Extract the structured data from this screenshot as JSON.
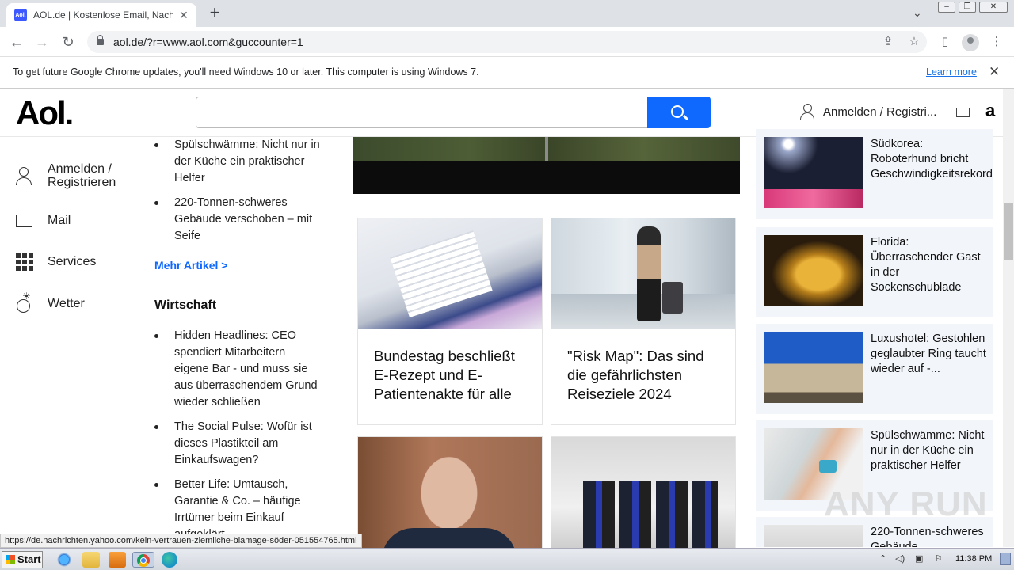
{
  "browser": {
    "tab_title": "AOL.de | Kostenlose Email, Nachrichten",
    "favicon_text": "Aol.",
    "url": "aol.de/?r=www.aol.com&guccounter=1",
    "infobar_message": "To get future Google Chrome updates, you'll need Windows 10 or later. This computer is using Windows 7.",
    "infobar_link": "Learn more",
    "status_url": "https://de.nachrichten.yahoo.com/kein-vertrauen-ziemliche-blamage-söder-051554765.html"
  },
  "header": {
    "logo": "Aol.",
    "search_placeholder": "",
    "login_label": "Anmelden / Registri...",
    "amazon": "a"
  },
  "left_nav": {
    "items": [
      {
        "label": "Anmelden / Registrieren",
        "icon": "person-icon"
      },
      {
        "label": "Mail",
        "icon": "mail-icon"
      },
      {
        "label": "Services",
        "icon": "grid-icon"
      },
      {
        "label": "Wetter",
        "icon": "weather-icon"
      }
    ]
  },
  "articles": {
    "top_list": [
      "Spülschwämme: Nicht nur in der Küche ein praktischer Helfer",
      "220-Tonnen-schweres Gebäude verschoben – mit Seife"
    ],
    "more_link": "Mehr Artikel >",
    "section_title": "Wirtschaft",
    "wirtschaft_list": [
      "Hidden Headlines: CEO spendiert Mitarbeitern eigene Bar - und muss sie aus überraschendem Grund wieder schließen",
      "The Social Pulse: Wofür ist dieses Plastikteil am Einkaufswagen?",
      "Better Life: Umtausch, Garantie & Co. – häufige Irrtümer beim Einkauf aufgeklärt"
    ]
  },
  "cards": [
    {
      "title": "Bundestag beschließt E-Rezept und E-Patientenakte für alle"
    },
    {
      "title": "\"Risk Map\": Das sind die gefährlichsten Reiseziele 2024"
    }
  ],
  "right_rail": [
    {
      "title": "Südkorea: Roboterhund bricht Geschwindigkeitsrekord"
    },
    {
      "title": "Florida: Überraschender Gast in der Sockenschublade"
    },
    {
      "title": "Luxushotel: Gestohlen geglaubter Ring taucht wieder auf -..."
    },
    {
      "title": "Spülschwämme: Nicht nur in der Küche ein praktischer Helfer"
    },
    {
      "title": "220-Tonnen-schweres Gebäude"
    }
  ],
  "taskbar": {
    "start_label": "Start",
    "clock": "11:38 PM"
  },
  "watermark": "ANY RUN",
  "colors": {
    "aol_blue": "#0f69ff",
    "rail_bg": "#f2f5fa"
  }
}
